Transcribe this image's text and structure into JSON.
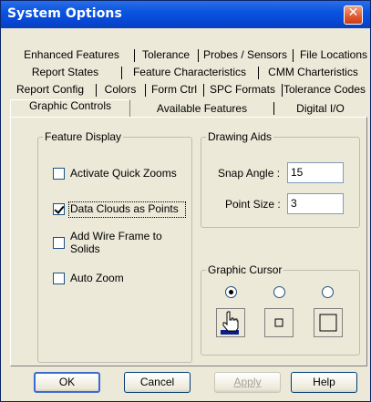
{
  "window": {
    "title": "System Options",
    "close_glyph": "✕"
  },
  "tabs": {
    "row1": [
      "Enhanced Features",
      "Tolerance",
      "Probes / Sensors",
      "File Locations"
    ],
    "row2": [
      "Report States",
      "Feature Characteristics",
      "CMM Charteristics"
    ],
    "row3": [
      "Report Config",
      "Colors",
      "Form Ctrl",
      "SPC Formats",
      "Tolerance Codes"
    ],
    "row4": [
      "Graphic Controls",
      "Available Features",
      "Digital I/O"
    ],
    "active": "Graphic Controls"
  },
  "feature_display": {
    "title": "Feature Display",
    "items": [
      {
        "label": "Activate Quick Zooms",
        "checked": false
      },
      {
        "label": "Data Clouds as Points",
        "checked": true
      },
      {
        "label_line1": "Add Wire Frame to",
        "label_line2": "Solids",
        "checked": false
      },
      {
        "label": "Auto Zoom",
        "checked": false
      }
    ]
  },
  "drawing_aids": {
    "title": "Drawing Aids",
    "snap_angle": {
      "label": "Snap Angle :",
      "value": "15"
    },
    "point_size": {
      "label": "Point Size :",
      "value": "3"
    }
  },
  "graphic_cursor": {
    "title": "Graphic Cursor",
    "options": [
      {
        "icon": "hand-pointer-icon",
        "selected": true
      },
      {
        "icon": "small-square-icon",
        "selected": false
      },
      {
        "icon": "large-square-icon",
        "selected": false
      }
    ]
  },
  "buttons": {
    "ok": "OK",
    "cancel": "Cancel",
    "apply": "Apply",
    "help": "Help"
  }
}
